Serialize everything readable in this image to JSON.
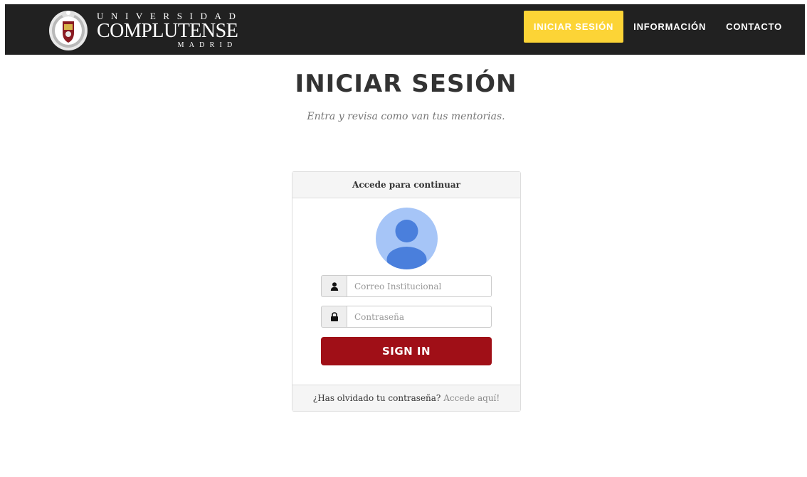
{
  "brand": {
    "line1": "UNIVERSIDAD",
    "line2": "COMPLUTENSE",
    "line3": "MADRID"
  },
  "nav": {
    "items": [
      {
        "label": "INICIAR SESIÓN",
        "active": true
      },
      {
        "label": "INFORMACIÓN",
        "active": false
      },
      {
        "label": "CONTACTO",
        "active": false
      }
    ]
  },
  "page": {
    "title": "INICIAR SESIÓN",
    "subtitle": "Entra y revisa como van tus mentorias."
  },
  "login": {
    "header": "Accede para continuar",
    "email_placeholder": "Correo Institucional",
    "password_placeholder": "Contraseña",
    "submit_label": "SIGN IN",
    "forgot_text": "¿Has olvidado tu contraseña?",
    "forgot_link": "Accede aquí!"
  },
  "colors": {
    "navbar": "#212121",
    "accent": "#fcd436",
    "submit": "#a00f17",
    "avatar_bg": "#a6c5f7",
    "avatar_fg": "#4a7fdc"
  },
  "icons": {
    "email_addon": "user-icon",
    "password_addon": "lock-icon"
  }
}
